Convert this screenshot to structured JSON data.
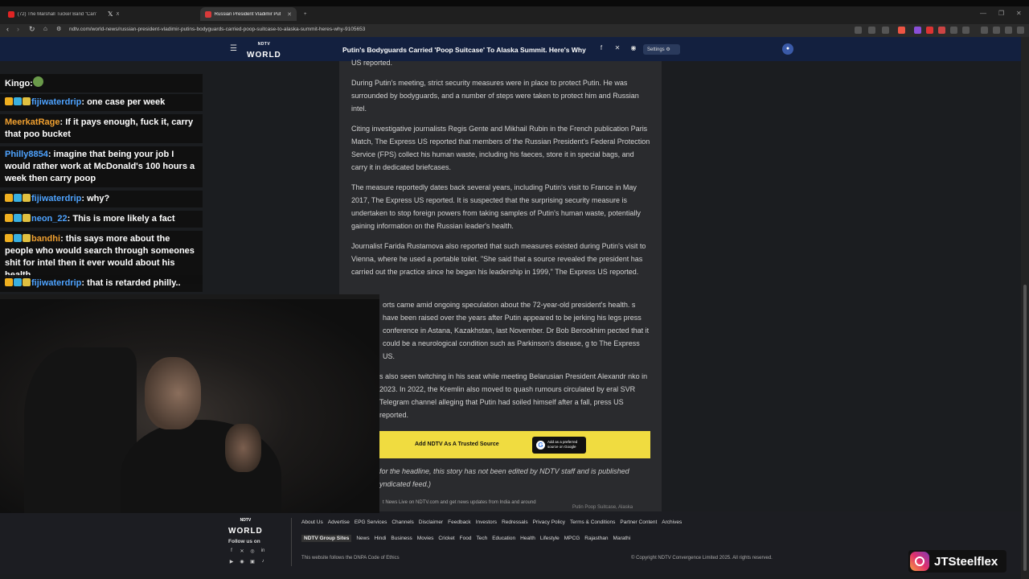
{
  "browser": {
    "tabs": [
      {
        "label": "(72) The Marshall Tucker Band \"Can't",
        "color": "#e02424"
      },
      {
        "label": "X",
        "color": "#ffffff"
      },
      {
        "label": "Russian President Vladimir Putin",
        "color": "#d83a3a",
        "active": true
      }
    ],
    "new_tab": "+",
    "url": "ndtv.com/world-news/russian-president-vladimir-putins-bodyguards-carried-poop-suitcase-to-alaska-summit-heres-why-9105653"
  },
  "header": {
    "logo_top": "NDTV",
    "logo_bottom": "WORLD",
    "title": "Putin's Bodyguards Carried 'Poop Suitcase' To Alaska Summit. Here's Why",
    "settings_label": "Settings"
  },
  "article": {
    "p0": "US reported.",
    "p1": "During Putin's meeting, strict security measures were in place to protect Putin. He was surrounded by bodyguards, and a number of steps were taken to protect him and Russian intel.",
    "p2": "Citing investigative journalists Regis Gente and Mikhail Rubin in the French publication Paris Match, The Express US reported that members of the Russian President's Federal Protection Service (FPS) collect his human waste, including his faeces, store it in special bags, and carry it in dedicated briefcases.",
    "p3": "The measure reportedly dates back several years, including Putin's visit to France in May 2017, The Express US reported. It is suspected that the surprising security measure is undertaken to stop foreign powers from taking samples of Putin's human waste, potentially gaining information on the Russian leader's health.",
    "p4": "Journalist Farida Rustamova also reported that such measures existed during Putin's visit to Vienna, where he used a portable toilet. \"She said that a source revealed the president has carried out the practice since he began his leadership in 1999,\" The Express US reported.",
    "p5": "orts came amid ongoing speculation about the 72-year-old president's health. s have been raised over the years after Putin appeared to be jerking his legs press conference in Astana, Kazakhstan, last November. Dr Bob Berookhim pected that it could be a neurological condition such as Parkinson's disease, g to The Express US.",
    "p6": "s also seen twitching in his seat while meeting Belarusian President Alexandr nko in 2023. In 2022, the Kremlin also moved to quash rumours circulated by eral SVR Telegram channel alleging that Putin had soiled himself after a fall, press US reported.",
    "cta_label": "Add NDTV As A Trusted Source",
    "google_btn": "Add as a preferred source on Google",
    "disclaimer": "for the headline, this story has not been edited by NDTV staff and is published yndicated feed.)",
    "trail_text": "t News Live on NDTV.com and get news updates from India and around",
    "trail_tag": "Putin Poop Suitcase, Alaska"
  },
  "footer": {
    "follow": "Follow us on",
    "links": [
      "About Us",
      "Advertise",
      "EPG Services",
      "Channels",
      "Disclaimer",
      "Feedback",
      "Investors",
      "Redressals",
      "Privacy Policy",
      "Terms & Conditions",
      "Partner Content",
      "Archives"
    ],
    "group_label": "NDTV Group Sites",
    "group_links": [
      "News",
      "Hindi",
      "Business",
      "Movies",
      "Cricket",
      "Food",
      "Tech",
      "Education",
      "Health",
      "Lifestyle",
      "MPCG",
      "Rajasthan",
      "Marathi"
    ],
    "ethics": "This website follows the DNPA Code of Ethics",
    "copyright": "© Copyright NDTV Convergence Limited 2025. All rights reserved."
  },
  "chat": [
    {
      "user": "Kingo",
      "color": "#ffffff",
      "text": ":",
      "emote": true
    },
    {
      "user": "fijiwaterdrip",
      "color": "#4ea3ff",
      "text": ": one case per week",
      "badges": true
    },
    {
      "user": "MeerkatRage",
      "color": "#f0a030",
      "text": ": If it pays enough, fuck it, carry that poo bucket"
    },
    {
      "user": "Philly8854",
      "color": "#4ea3ff",
      "text": ": imagine that being your job I would rather work at McDonald's 100 hours a week then carry poop"
    },
    {
      "user": "fijiwaterdrip",
      "color": "#4ea3ff",
      "text": ": why?",
      "badges": true
    },
    {
      "user": "neon_22",
      "color": "#4ea3ff",
      "text": ": This is more likely a fact",
      "badges": true
    },
    {
      "user": "bandhi",
      "color": "#f0a030",
      "text": ": this says more about the people who would search through someones shit for intel then it ever would about his health",
      "badges": true
    },
    {
      "user": "fijiwaterdrip",
      "color": "#4ea3ff",
      "text": ": that is retarded philly..",
      "badges": true
    }
  ],
  "brand": {
    "name": "JTSteelflex"
  }
}
